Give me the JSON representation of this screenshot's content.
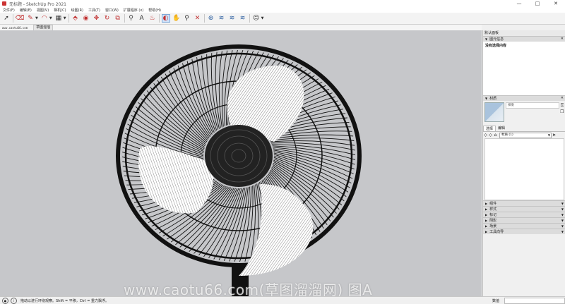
{
  "window": {
    "title": "无标题 - SketchUp Pro 2021",
    "controls": [
      "—",
      "□",
      "✕"
    ]
  },
  "menu": [
    "文件(F)",
    "编辑(E)",
    "视图(V)",
    "相机(C)",
    "绘图(R)",
    "工具(T)",
    "窗口(W)",
    "扩展程序 (x)",
    "帮助(H)"
  ],
  "scenes": {
    "site": "www.caotu66.com",
    "tab": "草图溜溜"
  },
  "watermark": "www.caotu66.com(草图溜溜网) 图A",
  "panel": {
    "title": "默认面板",
    "entity_info": {
      "header": "图元信息",
      "body": "没有选择内容"
    },
    "materials": {
      "header": "材质",
      "name_placeholder": "择染",
      "tab_select": "选择",
      "tab_edit": "编辑",
      "library": "材质 (1)"
    },
    "collapsed": [
      "组件",
      "样式",
      "标记",
      "阴影",
      "场景",
      "工具向导"
    ]
  },
  "status": {
    "hint": "拖动以进行环绕观察。Shift = 平移，Ctrl = 重力飘浮。",
    "measure_label": "数值",
    "measure_value": ""
  },
  "colors": {
    "viewport_bg": "#c6c7ca",
    "fan_black": "#111111",
    "blade_white": "#ffffff",
    "tool_blue": "#2a5d9f"
  }
}
